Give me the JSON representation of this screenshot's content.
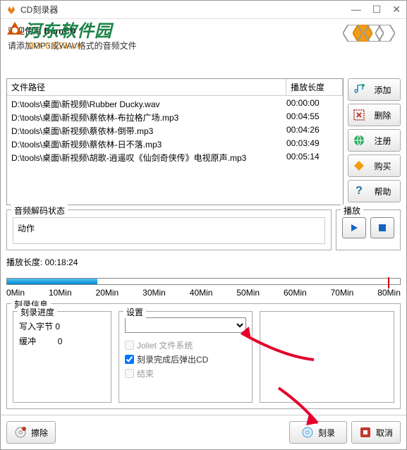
{
  "titlebar": {
    "title": "CD刻录器"
  },
  "header": {
    "welcome_prefix": "欢迎使用 ",
    "welcome_name": "BurnCD",
    "prompt": "请添加MP3或WAV格式的音频文件"
  },
  "watermark": {
    "text": "河东软件园",
    "url": "NO:0359.cn"
  },
  "fileList": {
    "col_path": "文件路径",
    "col_dur": "播放长度",
    "rows": [
      {
        "path": "D:\\tools\\桌面\\新视频\\Rubber Ducky.wav",
        "dur": "00:00:00"
      },
      {
        "path": "D:\\tools\\桌面\\新视频\\蔡依林-布拉格广场.mp3",
        "dur": "00:04:55"
      },
      {
        "path": "D:\\tools\\桌面\\新视频\\蔡依林-倒带.mp3",
        "dur": "00:04:26"
      },
      {
        "path": "D:\\tools\\桌面\\新视频\\蔡依林-日不落.mp3",
        "dur": "00:03:49"
      },
      {
        "path": "D:\\tools\\桌面\\新视频\\胡歌-逍遥叹《仙剑奇侠传》电视原声.mp3",
        "dur": "00:05:14"
      }
    ]
  },
  "sideButtons": {
    "add": "添加",
    "delete": "删除",
    "register": "注册",
    "buy": "购买",
    "help": "帮助"
  },
  "decode": {
    "title": "音频解码状态",
    "action_label": "动作"
  },
  "play": {
    "title": "播放"
  },
  "duration": {
    "label": "播放长度: 00:18:24"
  },
  "timeline": {
    "ticks": [
      "0Min",
      "10Min",
      "20Min",
      "30Min",
      "40Min",
      "50Min",
      "60Min",
      "70Min",
      "80Min"
    ],
    "fill_percent": 23,
    "marker_percent": 97
  },
  "burn": {
    "title": "刻录信息",
    "progress": {
      "title": "刻录进度",
      "written_label": "写入字节",
      "written_val": "0",
      "buffer_label": "缓冲",
      "buffer_val": "0"
    },
    "settings": {
      "title": "设置",
      "joliet": "Joliet 文件系统",
      "eject": "刻录完成后弹出CD",
      "finish": "结束"
    }
  },
  "bottom": {
    "erase": "擦除",
    "burn": "刻录",
    "cancel": "取消"
  }
}
